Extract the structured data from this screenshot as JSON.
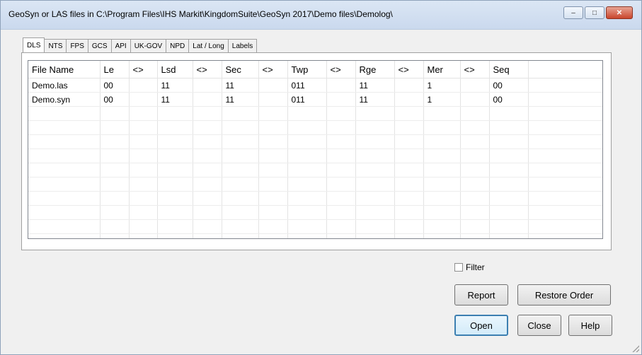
{
  "window": {
    "title": "GeoSyn or LAS files in C:\\Program Files\\IHS Markit\\KingdomSuite\\GeoSyn 2017\\Demo files\\Demolog\\",
    "minimize_symbol": "–",
    "maximize_symbol": "□",
    "close_symbol": "✕"
  },
  "tabs": [
    {
      "label": "DLS",
      "active": true
    },
    {
      "label": "NTS",
      "active": false
    },
    {
      "label": "FPS",
      "active": false
    },
    {
      "label": "GCS",
      "active": false
    },
    {
      "label": "API",
      "active": false
    },
    {
      "label": "UK-GOV",
      "active": false
    },
    {
      "label": "NPD",
      "active": false
    },
    {
      "label": "Lat / Long",
      "active": false
    },
    {
      "label": "Labels",
      "active": false
    }
  ],
  "table": {
    "columns": [
      "File Name",
      "Le",
      "<>",
      "Lsd",
      "<>",
      "Sec",
      "<>",
      "Twp",
      "<>",
      "Rge",
      "<>",
      "Mer",
      "<>",
      "Seq",
      ""
    ],
    "rows": [
      [
        "Demo.las",
        "00",
        "",
        "11",
        "",
        "11",
        "",
        "011",
        "",
        "11",
        "",
        "1",
        "",
        "00",
        ""
      ],
      [
        "Demo.syn",
        "00",
        "",
        "11",
        "",
        "11",
        "",
        "011",
        "",
        "11",
        "",
        "1",
        "",
        "00",
        ""
      ]
    ]
  },
  "filter": {
    "label": "Filter",
    "checked": false
  },
  "buttons": {
    "report": "Report",
    "restore_order": "Restore Order",
    "open": "Open",
    "close": "Close",
    "help": "Help"
  }
}
